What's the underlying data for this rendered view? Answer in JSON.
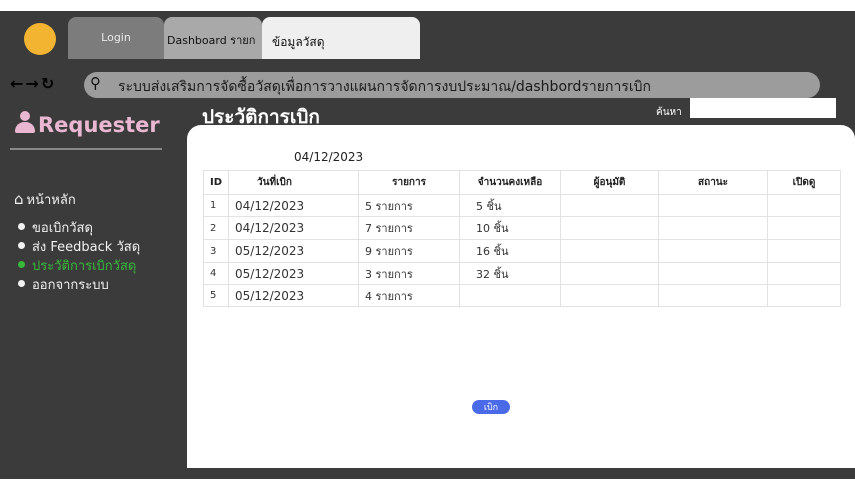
{
  "tabs": {
    "login": "Login",
    "dashboard": "Dashboard รายก",
    "active": "ข้อมูลวัสดุ"
  },
  "addressbar": {
    "url": "ระบบส่งเสริมการจัดซื้อวัสดุเพื่อการวางแผนการจัดการงบประมาณ/dashbordรายการเบิก"
  },
  "sidebar": {
    "brand": "Requester",
    "home": "หน้าหลัก",
    "items": [
      {
        "label": "ขอเบิกวัสดุ"
      },
      {
        "label": "ส่ง Feedback วัสดุ"
      },
      {
        "label": "ประวัติการเบิกวัสดุ"
      },
      {
        "label": "ออกจากระบบ"
      }
    ]
  },
  "main": {
    "title": "ประวัติการเบิก",
    "search_label": "ค้นหา",
    "search_value": "",
    "date": "04/12/2023",
    "columns": [
      "ID",
      "วันที่เบิก",
      "รายการ",
      "จำนวนคงเหลือ",
      "ผู้อนุมัติ",
      "สถานะ",
      "เปิดดู"
    ],
    "rows": [
      {
        "id": "1",
        "date": "04/12/2023",
        "items": "5 รายการ",
        "remaining": "5 ชิ้น"
      },
      {
        "id": "2",
        "date": "04/12/2023",
        "items": "7 รายการ",
        "remaining": "10 ชิ้น"
      },
      {
        "id": "3",
        "date": "05/12/2023",
        "items": "9 รายการ",
        "remaining": "16 ชิ้น"
      },
      {
        "id": "4",
        "date": "05/12/2023",
        "items": "3 รายการ",
        "remaining": "32 ชิ้น"
      },
      {
        "id": "5",
        "date": "05/12/2023",
        "items": "4 รายการ",
        "remaining": ""
      }
    ],
    "withdraw_button": "เบิก"
  },
  "colors": {
    "frame": "#3b3b3b",
    "avatar": "#f2b431",
    "brand": "#e9b7d1",
    "active_menu": "#38b93a",
    "button": "#4a6ae8"
  },
  "icons": [
    "avatar-icon",
    "back-arrow-icon",
    "forward-arrow-icon",
    "reload-icon",
    "search-icon",
    "person-icon",
    "home-icon",
    "bullet-icon"
  ]
}
